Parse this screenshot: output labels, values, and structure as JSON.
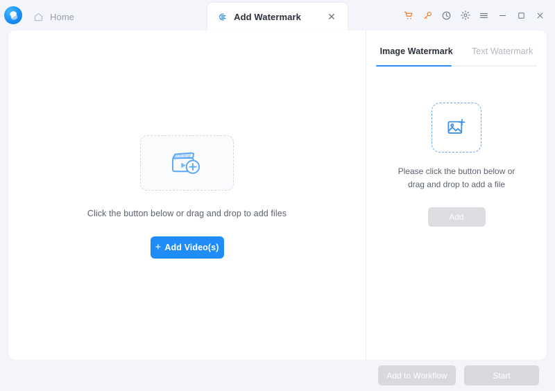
{
  "app": {
    "logo_icon": "brand-swirl-logo"
  },
  "titlebar": {
    "tabs": [
      {
        "label": "Home",
        "icon": "home-icon",
        "active": false,
        "closable": false
      },
      {
        "label": "Add Watermark",
        "icon": "watermark-icon",
        "active": true,
        "closable": true,
        "close_glyph": "✕"
      }
    ],
    "window_icons": [
      {
        "name": "cart-icon",
        "glyph": "🛒",
        "color": "#f07c22"
      },
      {
        "name": "key-icon",
        "glyph": "🔑",
        "color": "#f07c22"
      },
      {
        "name": "history-icon",
        "glyph": "◴",
        "color": "#6a6f7c"
      },
      {
        "name": "settings-gear-icon",
        "glyph": "⚙",
        "color": "#6a6f7c"
      },
      {
        "name": "menu-icon",
        "glyph": "≡",
        "color": "#6a6f7c"
      },
      {
        "name": "minimize-icon",
        "glyph": "−",
        "color": "#6a6f7c"
      },
      {
        "name": "maximize-icon",
        "glyph": "□",
        "color": "#6a6f7c"
      },
      {
        "name": "close-icon",
        "glyph": "✕",
        "color": "#6a6f7c"
      }
    ]
  },
  "main": {
    "dropzone_icon": "video-add-clapperboard-icon",
    "hint": "Click the button below or drag and drop to add files",
    "add_video_button": {
      "label": "Add Video(s)",
      "plus": "+",
      "color": "#1f8cf7"
    }
  },
  "sidebar": {
    "tabs": [
      {
        "label": "Image Watermark",
        "active": true
      },
      {
        "label": "Text Watermark",
        "active": false
      }
    ],
    "accent_color": "#2a8df5",
    "dropzone_icon": "image-add-icon",
    "hint_line1": "Please click the button below or",
    "hint_line2": "drag and drop to add a file",
    "add_button": {
      "label": "Add",
      "disabled": true,
      "color": "#dcdde1"
    }
  },
  "footer": {
    "add_to_workflow_label": "Add to Workflow",
    "start_label": "Start",
    "disabled_color": "#d8d9dd"
  }
}
